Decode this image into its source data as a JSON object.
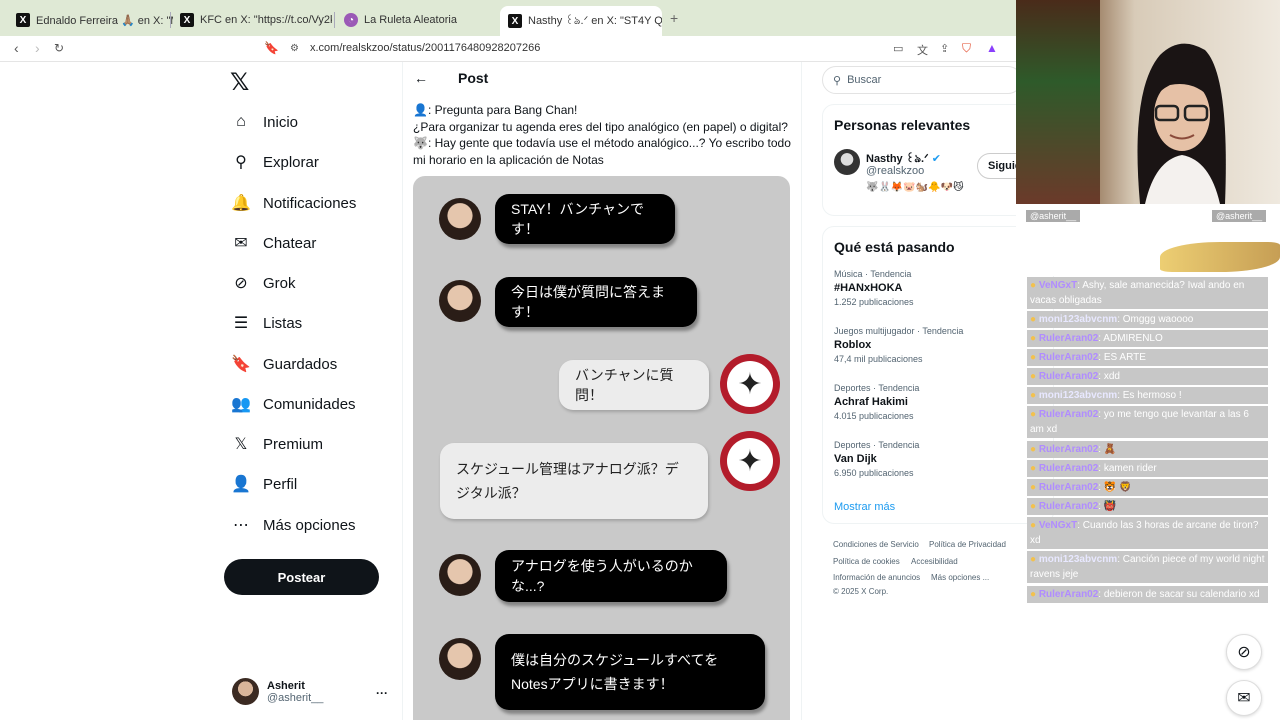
{
  "tabs": [
    {
      "title": "Ednaldo Ferreira 🙏🏽 en X: \"Mon",
      "icon": "X"
    },
    {
      "title": "KFC en X: \"https://t.co/Vy2krYQLsH\"",
      "icon": "X"
    },
    {
      "title": "La Ruleta Aleatoria",
      "icon": "◔"
    },
    {
      "title": "Nasthy ꒰ঌ.ᐟ en X: \"ST4Y Q&am",
      "icon": "X"
    }
  ],
  "url": "x.com/realskzoo/status/2001176480928207266",
  "nav": [
    {
      "label": "Inicio",
      "icon": "⌂"
    },
    {
      "label": "Explorar",
      "icon": "⚲"
    },
    {
      "label": "Notificaciones",
      "icon": "🔔"
    },
    {
      "label": "Chatear",
      "icon": "✉"
    },
    {
      "label": "Grok",
      "icon": "⊘"
    },
    {
      "label": "Listas",
      "icon": "☰"
    },
    {
      "label": "Guardados",
      "icon": "🔖"
    },
    {
      "label": "Comunidades",
      "icon": "👥"
    },
    {
      "label": "Premium",
      "icon": "𝕏"
    },
    {
      "label": "Perfil",
      "icon": "👤"
    },
    {
      "label": "Más opciones",
      "icon": "⋯"
    }
  ],
  "post_button": "Postear",
  "account": {
    "name": "Asherit",
    "handle": "@asherit__"
  },
  "post_header": "Post",
  "tweet_lines": [
    "👤: Pregunta para Bang Chan!",
    "¿Para organizar tu agenda eres del tipo analógico (en papel) o digital?",
    "🐺: Hay gente que todavía use el método analógico...? Yo escribo todo mi horario en la aplicación de Notas"
  ],
  "bubbles": [
    "STAY！バンチャンです！",
    "今日は僕が質問に答えます！",
    "バンチャンに質問！",
    "スケジュール管理はアナログ派？デジタル派？",
    "アナログを使う人がいるのかな...?",
    "僕は自分のスケジュールすべてをNotesアプリに書きます！"
  ],
  "search_placeholder": "Buscar",
  "relevant": {
    "title": "Personas relevantes",
    "name": "Nasthy ꒰ঌ.ᐟ",
    "handle": "@realskzoo",
    "follow": "Siguie",
    "bio": "🐺🐰🦊🐷🐿️🐥🐶😼"
  },
  "trending": {
    "title": "Qué está pasando",
    "items": [
      {
        "meta": "Música · Tendencia",
        "name": "#HANxHOKA",
        "count": "1.252 publicaciones"
      },
      {
        "meta": "Juegos multijugador · Tendencia",
        "name": "Roblox",
        "count": "47,4 mil publicaciones"
      },
      {
        "meta": "Deportes · Tendencia",
        "name": "Achraf Hakimi",
        "count": "4.015 publicaciones"
      },
      {
        "meta": "Deportes · Tendencia",
        "name": "Van Dijk",
        "count": "6.950 publicaciones"
      }
    ],
    "more": "Mostrar más"
  },
  "footer": [
    "Condiciones de Servicio",
    "Política de Privacidad",
    "Política de cookies",
    "Accesibilidad",
    "Información de anuncios",
    "Más opciones ...",
    "© 2025 X Corp."
  ],
  "stream_tags": [
    "@asherit__",
    "@asherit__"
  ],
  "chat": [
    {
      "user": "VeNGxT",
      "msg": ": Ashy, sale amanecida? Iwal ando en vacas obligadas"
    },
    {
      "user": "moni123abvcnm",
      "msg": ": Omggg waoooo"
    },
    {
      "user": "RulerAran02",
      "msg": ": ADMIRENLO"
    },
    {
      "user": "RulerAran02",
      "msg": ": ES ARTE"
    },
    {
      "user": "RulerAran02",
      "msg": ": xdd"
    },
    {
      "user": "moni123abvcnm",
      "msg": ": Es hermoso !"
    },
    {
      "user": "RulerAran02",
      "msg": ": yo me tengo que levantar a las 6 am xd"
    },
    {
      "user": "RulerAran02",
      "msg": ": 🧸"
    },
    {
      "user": "RulerAran02",
      "msg": ": kamen rider"
    },
    {
      "user": "RulerAran02",
      "msg": ": 🐯 🦁"
    },
    {
      "user": "RulerAran02",
      "msg": ": 👹"
    },
    {
      "user": "VeNGxT",
      "msg": ": Cuando las 3 horas de arcane de tiron? xd"
    },
    {
      "user": "moni123abvcnm",
      "msg": ": Canción piece of my world night ravens jeje"
    },
    {
      "user": "RulerAran02",
      "msg": ": debieron de sacar su calendario xd"
    }
  ]
}
